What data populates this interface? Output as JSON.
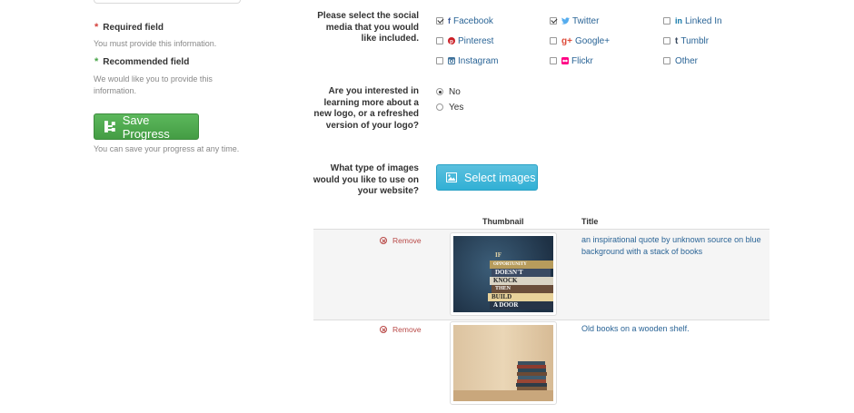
{
  "sidebar": {
    "required_title": "Required field",
    "required_help": "You must provide this information.",
    "recommended_title": "Recommended field",
    "recommended_help": "We would like you to provide this information.",
    "save_button": "Save Progress",
    "save_help": "You can save your progress at any time.",
    "star": "*"
  },
  "social": {
    "question": "Please select the social media that you would like included.",
    "options": [
      {
        "label": "Facebook",
        "icon": "facebook-icon",
        "checked": true
      },
      {
        "label": "Twitter",
        "icon": "twitter-icon",
        "checked": true
      },
      {
        "label": "Linked In",
        "icon": "linkedin-icon",
        "checked": false
      },
      {
        "label": "Pinterest",
        "icon": "pinterest-icon",
        "checked": false
      },
      {
        "label": "Google+",
        "icon": "googleplus-icon",
        "checked": false
      },
      {
        "label": "Tumblr",
        "icon": "tumblr-icon",
        "checked": false
      },
      {
        "label": "Instagram",
        "icon": "instagram-icon",
        "checked": false
      },
      {
        "label": "Flickr",
        "icon": "flickr-icon",
        "checked": false
      },
      {
        "label": "Other",
        "icon": "",
        "checked": false
      }
    ]
  },
  "logo": {
    "question": "Are you interested in learning more about a new logo, or a refreshed version of your logo?",
    "options": [
      {
        "label": "No",
        "selected": true
      },
      {
        "label": "Yes",
        "selected": false
      }
    ]
  },
  "images": {
    "question": "What type of images would you like to use on your website?",
    "select_button": "Select images",
    "headers": {
      "thumbnail": "Thumbnail",
      "title": "Title"
    },
    "rows": [
      {
        "remove": "Remove",
        "title": "an inspirational quote by unknown source on blue background with a stack of books",
        "book_words": [
          "IF",
          "OPPORTUNITY",
          "DOESN'T",
          "KNOCK",
          "THEN",
          "BUILD",
          "A DOOR"
        ]
      },
      {
        "remove": "Remove",
        "title": "Old books on a wooden shelf."
      }
    ]
  },
  "colors": {
    "success": "#5cb85c",
    "info": "#5bc0de",
    "link": "#2a6496",
    "danger": "#b94a48"
  }
}
